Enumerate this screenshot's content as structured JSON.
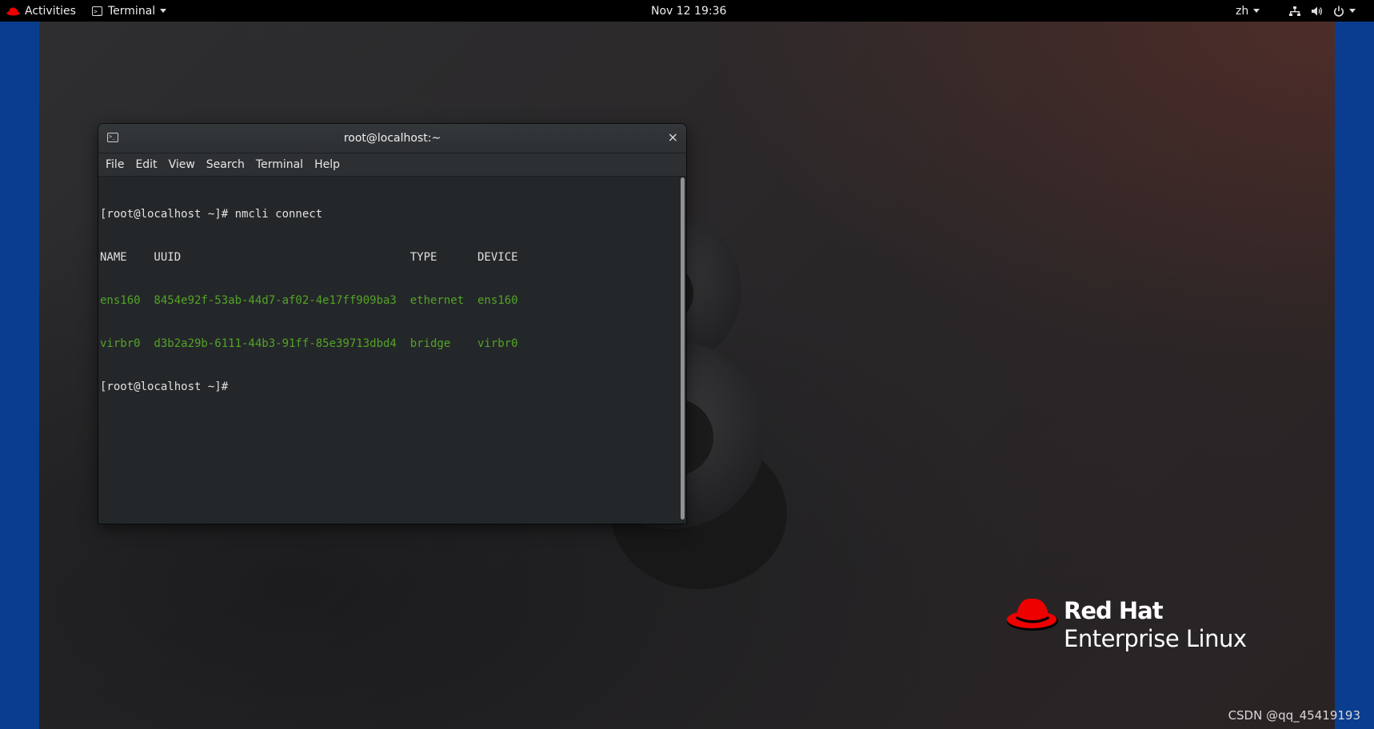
{
  "topbar": {
    "activities_label": "Activities",
    "app_label": "Terminal",
    "clock": "Nov 12  19:36",
    "language": "zh"
  },
  "terminal": {
    "title": "root@localhost:~",
    "close_glyph": "×",
    "menu": [
      "File",
      "Edit",
      "View",
      "Search",
      "Terminal",
      "Help"
    ],
    "lines": [
      {
        "text": "[root@localhost ~]# nmcli connect",
        "color": "#e0e0e0"
      },
      {
        "text": "NAME    UUID                                  TYPE      DEVICE",
        "color": "#e0e0e0"
      },
      {
        "text": "ens160  8454e92f-53ab-44d7-af02-4e17ff909ba3  ethernet  ens160",
        "color": "#53a328"
      },
      {
        "text": "virbr0  d3b2a29b-6111-44b3-91ff-85e39713dbd4  bridge    virbr0",
        "color": "#53a328"
      },
      {
        "text": "[root@localhost ~]# ",
        "color": "#e0e0e0"
      }
    ]
  },
  "branding": {
    "line1": "Red Hat",
    "line2": "Enterprise Linux"
  },
  "watermark": "CSDN @qq_45419193",
  "colors": {
    "accent_red": "#ee0000",
    "side_blue": "#0a3d8f",
    "terminal_green": "#53a328"
  },
  "icons": [
    "redhat-hat-icon",
    "terminal-icon",
    "network-icon",
    "volume-icon",
    "power-icon",
    "caret-down-icon",
    "close-icon"
  ]
}
